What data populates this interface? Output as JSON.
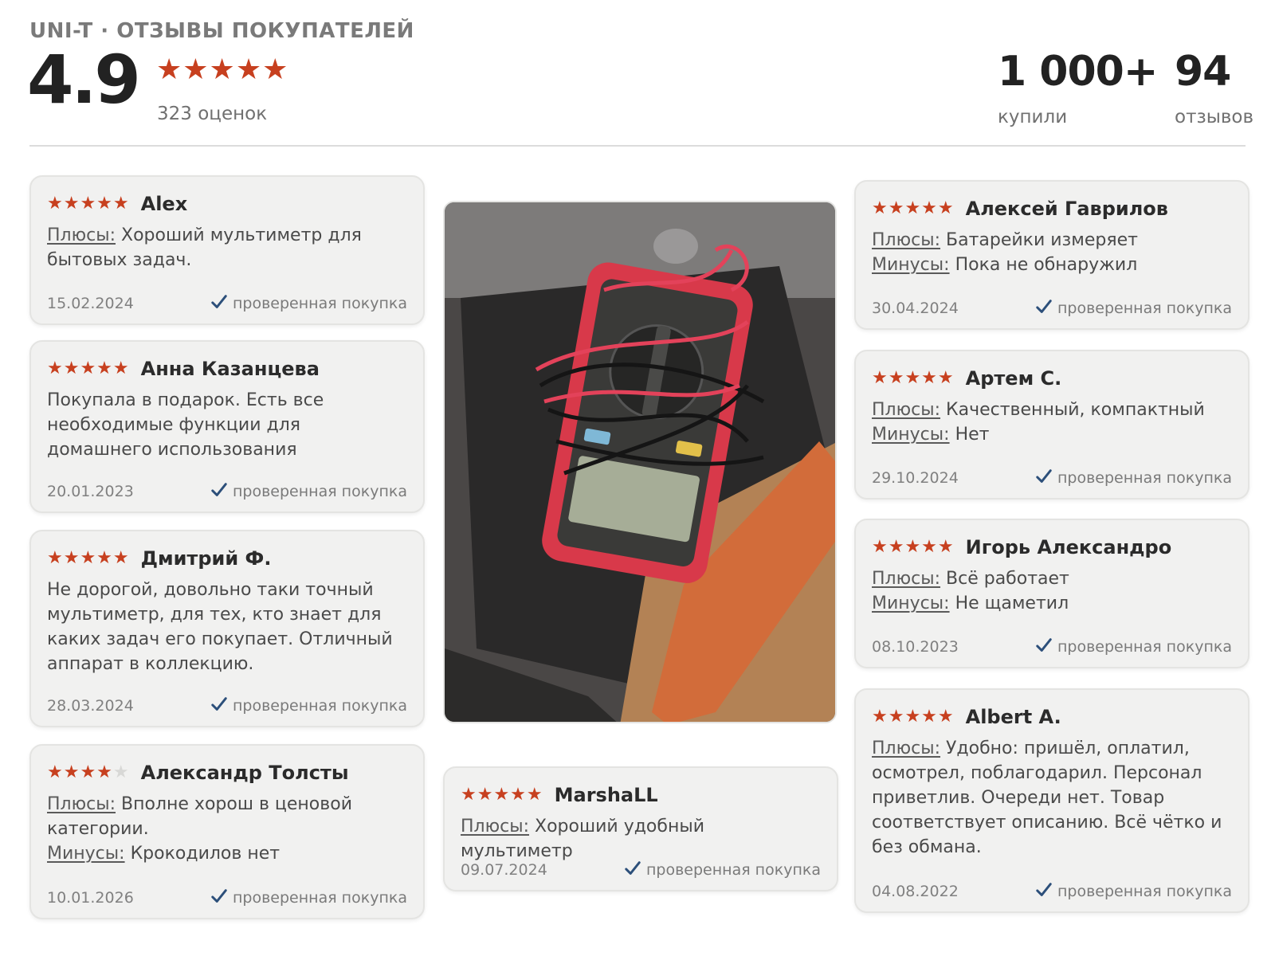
{
  "header": {
    "brand": "UNI-T · ОТЗЫВЫ ПОКУПАТЕЛЕЙ",
    "rating": "4.9",
    "stars": "★★★★★",
    "ratings_count": "323 оценок",
    "bought_value": "1 000+",
    "bought_label": "купили",
    "reviews_value": "94",
    "reviews_label": "отзывов"
  },
  "labels": {
    "pros": "Плюсы:",
    "cons": "Минусы:",
    "verified": "проверенная покупка"
  },
  "colors": {
    "star": "#c7401f",
    "star_off": "#d8d8d6",
    "check": "#2c4f7a"
  },
  "icons": {
    "check": "check-icon",
    "photo": "multimeter-photo"
  },
  "reviews": [
    {
      "author": "Alex",
      "stars": "★★★★★",
      "rating": 5,
      "pros": "Хороший мультиметр для бытовых задач.",
      "date": "15.02.2024"
    },
    {
      "author": "Анна Казанцева",
      "stars": "★★★★★",
      "rating": 5,
      "text": "Покупала в подарок. Есть все необходимые функции для домашнего использования",
      "date": "20.01.2023"
    },
    {
      "author": "Дмитрий Ф.",
      "stars": "★★★★★",
      "rating": 5,
      "text": "Не дорогой, довольно таки точный мультиметр, для тех, кто знает для каких задач его покупает. Отличный аппарат в коллекцию.",
      "date": "28.03.2024"
    },
    {
      "author": "Александр Толсты",
      "stars": "★★★★",
      "stars_off": "★",
      "rating": 4,
      "pros": "Вполне хорош в ценовой категории.",
      "cons": "Крокодилов нет",
      "date": "10.01.2026"
    },
    {
      "author": "MarshaLL",
      "stars": "★★★★★",
      "rating": 5,
      "pros": "Хороший удобный мультиметр",
      "date": "09.07.2024"
    },
    {
      "author": "Алексей Гаврилов",
      "stars": "★★★★★",
      "rating": 5,
      "pros": "Батарейки измеряет",
      "cons": "Пока не обнаружил",
      "date": "30.04.2024"
    },
    {
      "author": "Артем С.",
      "stars": "★★★★★",
      "rating": 5,
      "pros": "Качественный, компактный",
      "cons": "Нет",
      "date": "29.10.2024"
    },
    {
      "author": "Игорь Александро",
      "stars": "★★★★★",
      "rating": 5,
      "pros": "Всё работает",
      "cons": "Не щаметил",
      "date": "08.10.2023"
    },
    {
      "author": "Albert A.",
      "stars": "★★★★★",
      "rating": 5,
      "pros": "Удобно: пришёл, оплатил, осмотрел, поблагодарил. Персонал приветлив. Очереди нет. Товар соответствует описанию. Всё чётко и без обмана.",
      "date": "04.08.2022"
    }
  ]
}
